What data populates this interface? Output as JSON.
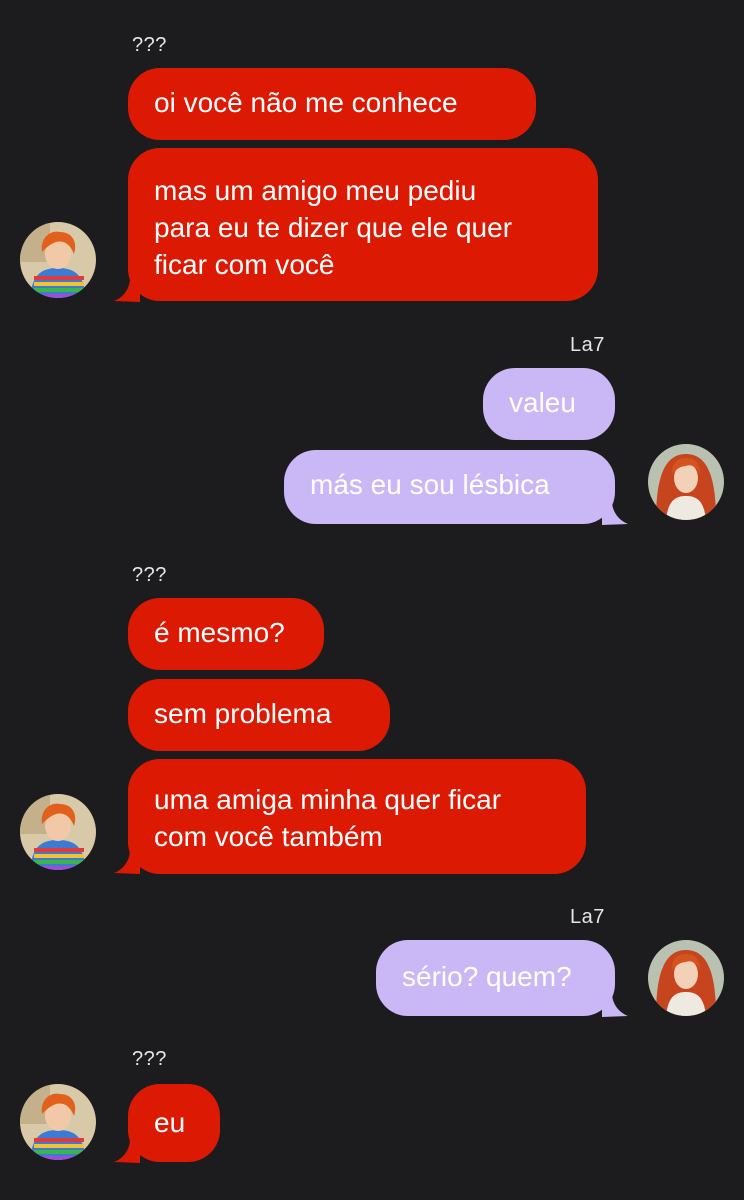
{
  "senders": {
    "unknown": "???",
    "me": "La7"
  },
  "messages": {
    "g1": [
      "oi você não me conhece",
      "mas um amigo meu pediu",
      "para eu te dizer que ele quer",
      "ficar com você"
    ],
    "g2": [
      "valeu",
      "más eu sou lésbica"
    ],
    "g3": [
      "é mesmo?",
      "sem problema",
      "uma amiga minha quer ficar",
      "com você também"
    ],
    "g4": [
      "sério? quem?"
    ],
    "g5": [
      "eu"
    ]
  },
  "avatars": {
    "unknown": "avatar-redhead-boy-striped-shirt",
    "me": "avatar-redhead-girl-white-dress"
  },
  "colors": {
    "background": "#1c1c1e",
    "incoming_bubble": "#dc1a04",
    "outgoing_bubble": "#c9b8f5",
    "text": "#ffffff"
  }
}
